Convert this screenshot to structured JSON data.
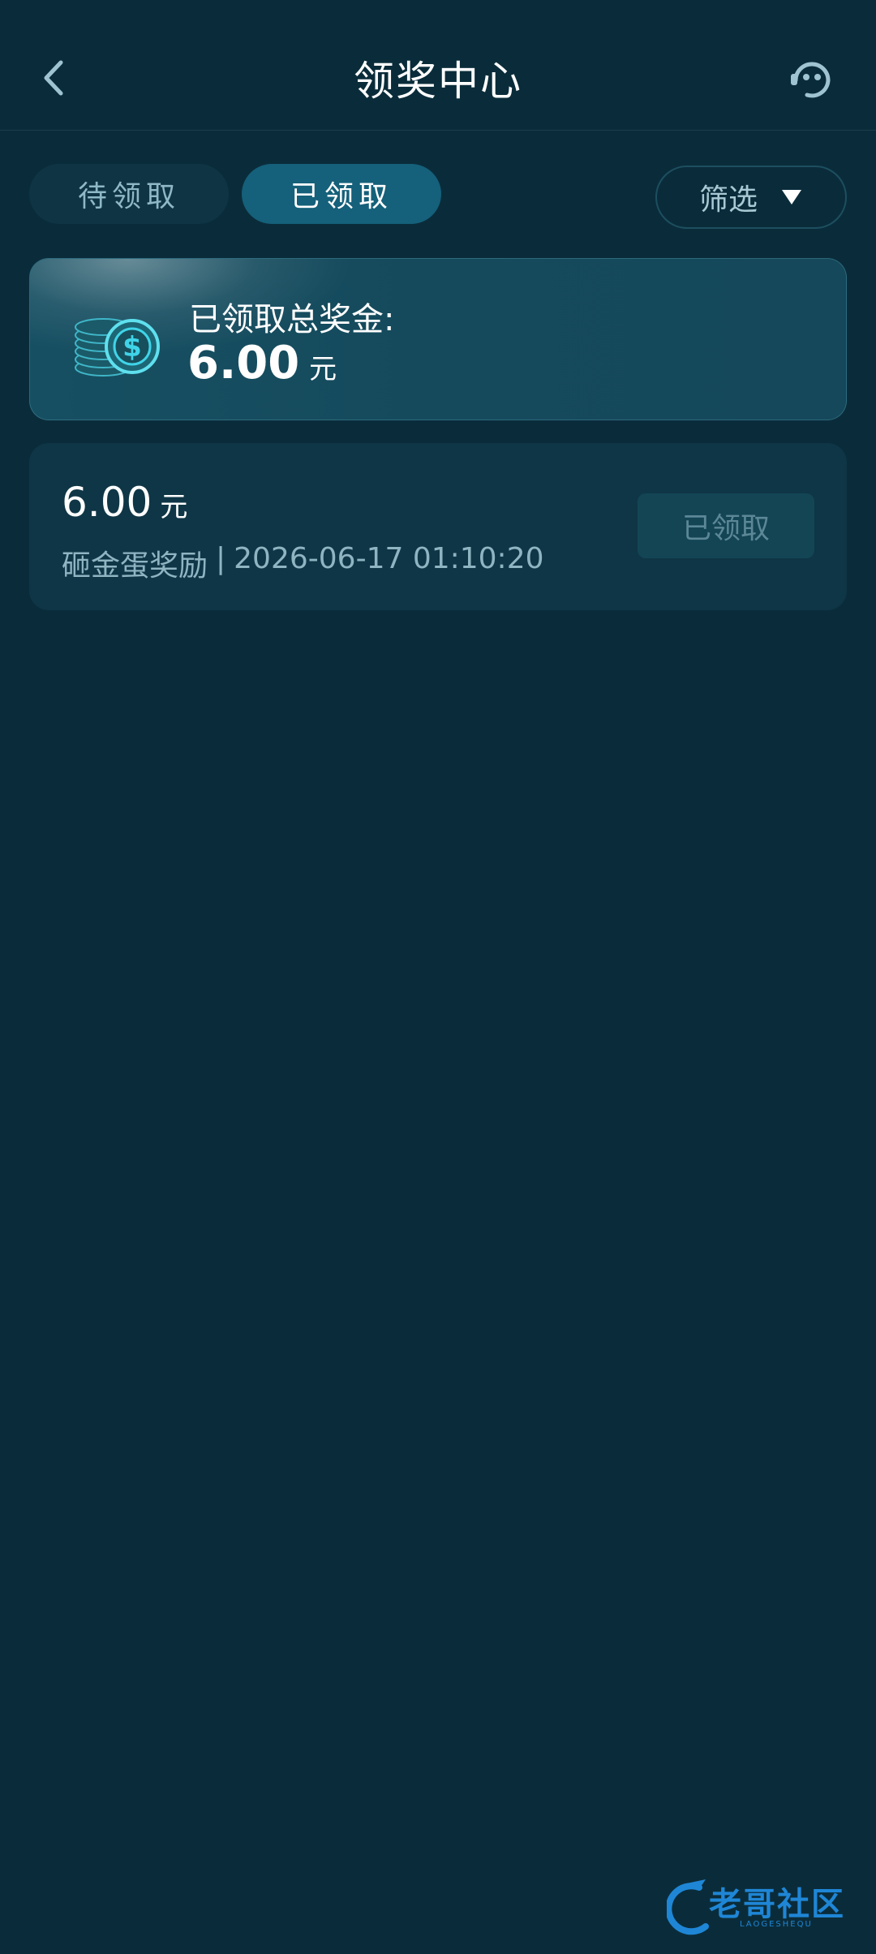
{
  "header": {
    "title": "领奖中心",
    "back_icon": "chevron-left-icon",
    "support_icon": "headset-chat-icon"
  },
  "tabs": [
    {
      "label": "待领取",
      "active": false
    },
    {
      "label": "已领取",
      "active": true
    }
  ],
  "filter": {
    "label": "筛选",
    "icon": "triangle-down-icon"
  },
  "summary": {
    "label": "已领取总奖金:",
    "amount": "6.00",
    "unit": "元",
    "icon": "coin-stack-icon"
  },
  "records": [
    {
      "amount": "6.00",
      "unit": "元",
      "source": "砸金蛋奖励",
      "separator": "|",
      "timestamp": "2026-06-17 01:10:20",
      "status": "已领取"
    }
  ],
  "watermark": {
    "text": "老哥社区",
    "subtext": "LAOGESHEQU"
  },
  "colors": {
    "background": "#0a2c3a",
    "card": "#0f3646",
    "active_tab": "#15607a",
    "accent_cyan": "#3fd4e8"
  }
}
